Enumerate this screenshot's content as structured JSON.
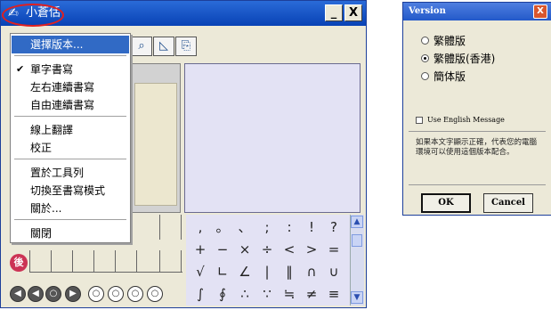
{
  "main_window": {
    "title": "小蒼佸",
    "minimize_label": "_",
    "close_label": "X",
    "toolbar_icons": [
      "zoom-icon",
      "chart-icon",
      "export-icon"
    ],
    "after_icon_label": "後"
  },
  "context_menu": {
    "items": [
      {
        "label": "選擇版本...",
        "highlighted": true,
        "checked": false
      },
      {
        "label": "單字書寫",
        "highlighted": false,
        "checked": true
      },
      {
        "label": "左右連續書寫",
        "highlighted": false,
        "checked": false
      },
      {
        "label": "自由連續書寫",
        "highlighted": false,
        "checked": false
      },
      {
        "label": "線上翻譯",
        "highlighted": false,
        "checked": false
      },
      {
        "label": "校正",
        "highlighted": false,
        "checked": false
      },
      {
        "label": "置於工具列",
        "highlighted": false,
        "checked": false
      },
      {
        "label": "切換至書寫模式",
        "highlighted": false,
        "checked": false
      },
      {
        "label": "關於...",
        "highlighted": false,
        "checked": false
      },
      {
        "label": "關閉",
        "highlighted": false,
        "checked": false
      }
    ],
    "check_glyph": "✔"
  },
  "symbols": [
    [
      ",",
      "。",
      "、",
      ";",
      ":",
      "!",
      "?"
    ],
    [
      "+",
      "−",
      "×",
      "÷",
      "<",
      ">",
      "="
    ],
    [
      "√",
      "∟",
      "∠",
      "|",
      "‖",
      "∩",
      "∪"
    ],
    [
      "∫",
      "∮",
      "∴",
      "∵",
      "≒",
      "≠",
      "≡"
    ]
  ],
  "bottom_buttons": [
    {
      "glyph": "◀",
      "style": "dark"
    },
    {
      "glyph": "◀",
      "style": "dark"
    },
    {
      "glyph": "○",
      "style": "dark"
    },
    {
      "glyph": "▶",
      "style": "dark"
    },
    {
      "glyph": "○",
      "style": "light"
    },
    {
      "glyph": "○",
      "style": "light"
    },
    {
      "glyph": "○",
      "style": "light"
    },
    {
      "glyph": "○",
      "style": "light"
    }
  ],
  "scroll": {
    "up": "▲",
    "down": "▼"
  },
  "version_dialog": {
    "title": "Version",
    "close_label": "X",
    "options": [
      {
        "label": "繁體版",
        "selected": false
      },
      {
        "label": "繁體版(香港)",
        "selected": true
      },
      {
        "label": "簡体版",
        "selected": false
      }
    ],
    "checkbox_label": "Use English Message",
    "checkbox_checked": false,
    "message": "如果本文字顯示正確，代表您的電腦環境可以使用這個版本配合。",
    "ok_label": "OK",
    "cancel_label": "Cancel"
  },
  "colors": {
    "title_bar": "#0842b5",
    "menu_highlight": "#316ac5",
    "pad_background": "#e3e2f4",
    "annotation_circle": "#e02020"
  }
}
